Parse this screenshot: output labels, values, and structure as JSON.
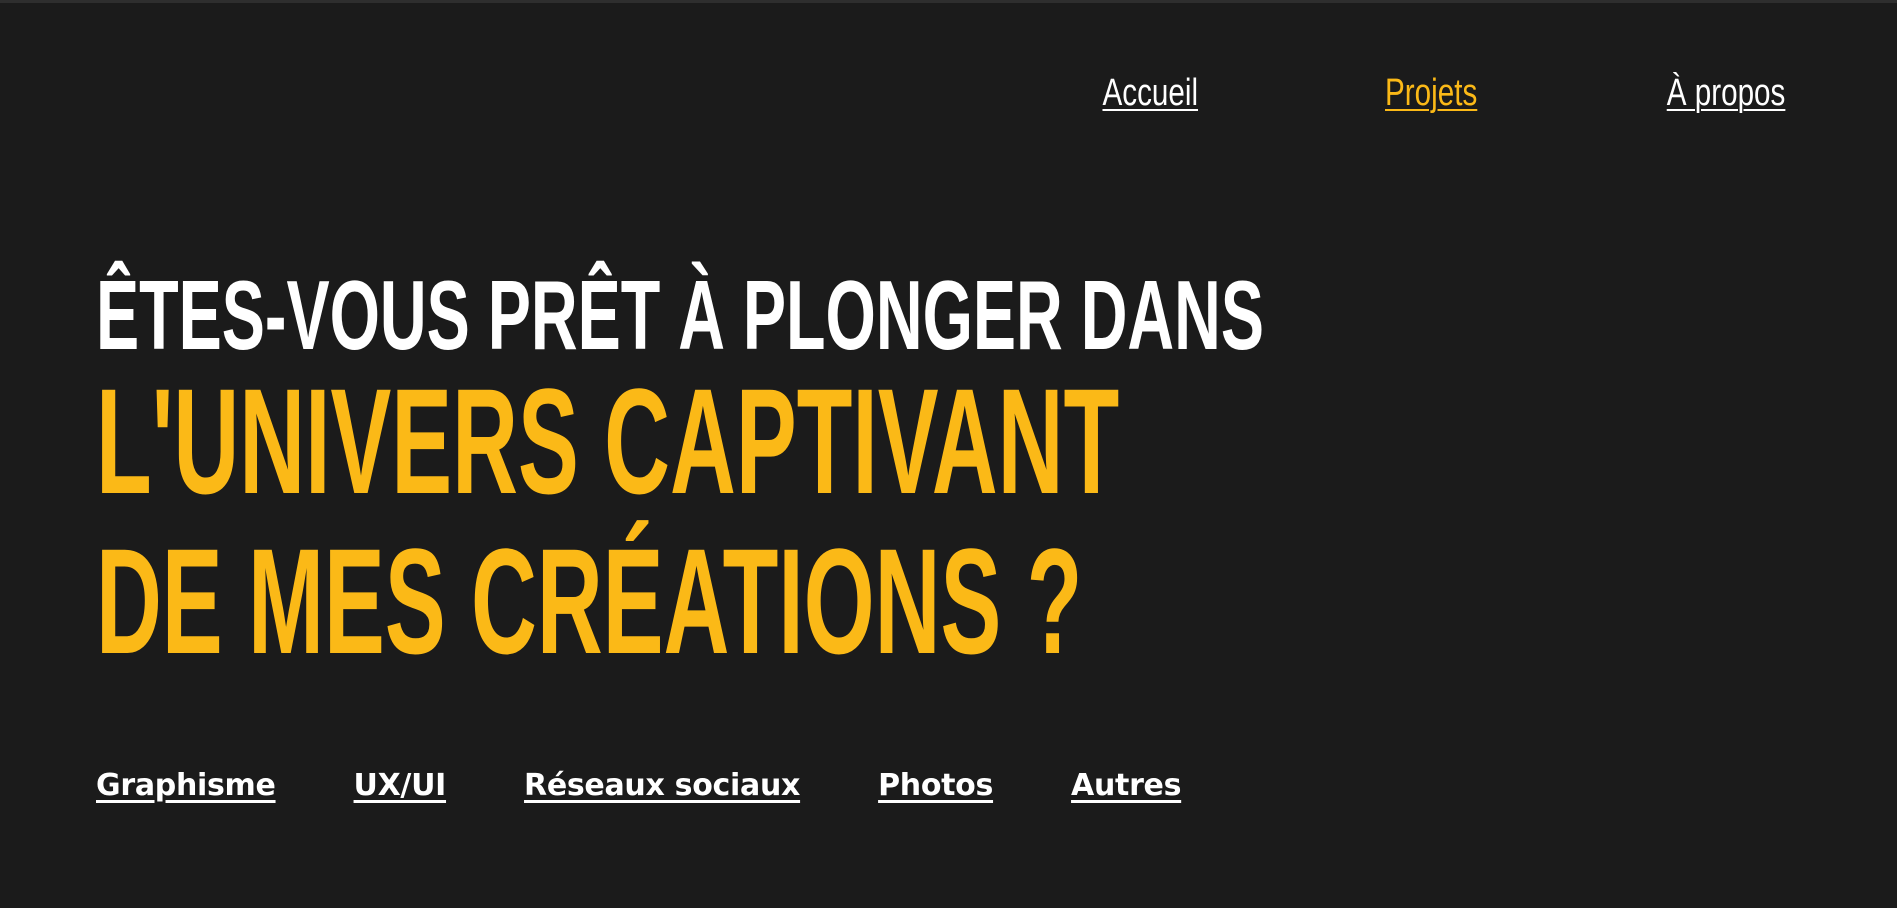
{
  "nav": {
    "items": [
      {
        "label": "Accueil",
        "active": false
      },
      {
        "label": "Projets",
        "active": true
      },
      {
        "label": "À propos",
        "active": false
      }
    ]
  },
  "hero": {
    "line1": "ÊTES-VOUS PRÊT À PLONGER DANS",
    "line2": "L'UNIVERS CAPTIVANT",
    "line3": "DE MES CRÉATIONS ?"
  },
  "categories": {
    "items": [
      "Graphisme",
      "UX/UI",
      "Réseaux sociaux",
      "Photos",
      "Autres"
    ]
  },
  "colors": {
    "background": "#1b1b1b",
    "accent": "#fbb917",
    "text": "#ffffff"
  }
}
